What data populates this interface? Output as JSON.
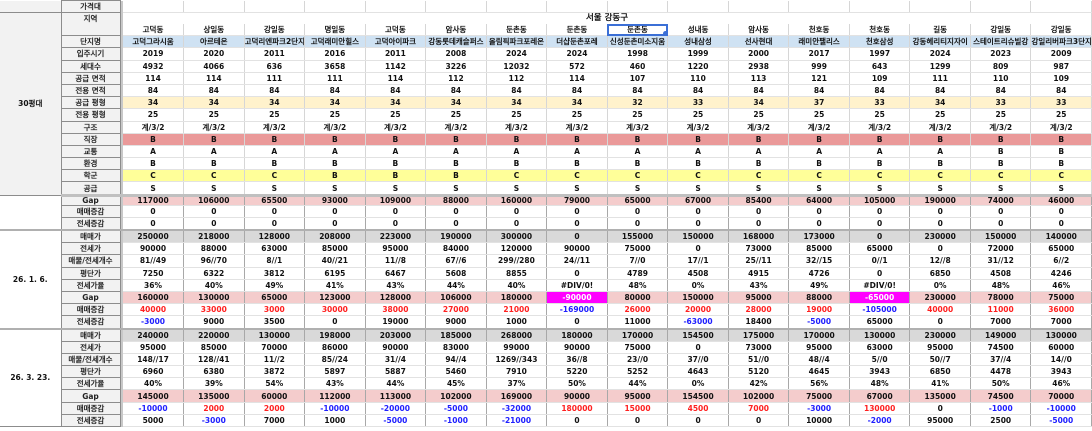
{
  "sheet": {
    "price_band_label": "가격대",
    "region_label": "지역",
    "region_title": "서울 강동구",
    "group_label": "30평대"
  },
  "dongs": [
    "고덕동",
    "상일동",
    "강일동",
    "명일동",
    "고덕동",
    "암사동",
    "둔촌동",
    "둔촌동",
    "둔촌동",
    "성내동",
    "암사동",
    "천호동",
    "천호동",
    "길동",
    "강일동",
    "강일동"
  ],
  "info_rows": [
    {
      "label": "단지명",
      "style": "blue",
      "values": [
        "고덕그라시움",
        "아르테온",
        "고덕리엔파크2단지",
        "고덕래미안힐스",
        "고덕아이파크",
        "강동롯데캐슬퍼스",
        "올림픽파크포레온",
        "더샵둔촌포레",
        "신성둔촌미소지움",
        "성내삼성",
        "선사현대",
        "래미안팰리스",
        "천호삼성",
        "강동헤리티지자이",
        "스테이트리슈빌강",
        "강일리버파크3단지"
      ]
    },
    {
      "label": "입주시기",
      "style": "",
      "values": [
        "2019",
        "2020",
        "2011",
        "2016",
        "2011",
        "2008",
        "2024",
        "2024",
        "1998",
        "1999",
        "2000",
        "2017",
        "1997",
        "2024",
        "2023",
        "2009"
      ]
    },
    {
      "label": "세대수",
      "style": "",
      "values": [
        "4932",
        "4066",
        "636",
        "3658",
        "1142",
        "3226",
        "12032",
        "572",
        "460",
        "1220",
        "2938",
        "999",
        "643",
        "1299",
        "809",
        "987"
      ]
    },
    {
      "label": "공급 면적",
      "style": "",
      "values": [
        "114",
        "114",
        "111",
        "111",
        "114",
        "112",
        "112",
        "114",
        "107",
        "110",
        "113",
        "121",
        "109",
        "111",
        "110",
        "109"
      ]
    },
    {
      "label": "전용 면적",
      "style": "",
      "values": [
        "84",
        "84",
        "84",
        "84",
        "84",
        "84",
        "84",
        "84",
        "84",
        "84",
        "84",
        "84",
        "84",
        "84",
        "84",
        "84"
      ]
    },
    {
      "label": "공급 평형",
      "style": "yellow-lite",
      "values": [
        "34",
        "34",
        "34",
        "34",
        "34",
        "34",
        "34",
        "34",
        "32",
        "33",
        "34",
        "37",
        "33",
        "34",
        "33",
        "33"
      ]
    },
    {
      "label": "전용 평형",
      "style": "",
      "values": [
        "25",
        "25",
        "25",
        "25",
        "25",
        "25",
        "25",
        "25",
        "25",
        "25",
        "25",
        "25",
        "25",
        "25",
        "25",
        "25"
      ]
    },
    {
      "label": "구조",
      "style": "",
      "values": [
        "계/3/2",
        "계/3/2",
        "계/3/2",
        "계/3/2",
        "계/3/2",
        "계/3/2",
        "계/3/2",
        "계/3/2",
        "계/3/2",
        "계/3/2",
        "계/3/2",
        "계/3/2",
        "계/3/2",
        "계/3/2",
        "계/3/2",
        "계/3/2"
      ]
    },
    {
      "label": "직장",
      "style": "red",
      "values": [
        "B",
        "B",
        "B",
        "B",
        "B",
        "B",
        "B",
        "B",
        "B",
        "B",
        "B",
        "B",
        "B",
        "B",
        "B",
        "B"
      ]
    },
    {
      "label": "교통",
      "style": "",
      "values": [
        "A",
        "A",
        "A",
        "A",
        "A",
        "A",
        "A",
        "A",
        "A",
        "A",
        "A",
        "A",
        "A",
        "A",
        "B",
        "B"
      ]
    },
    {
      "label": "환경",
      "style": "",
      "values": [
        "B",
        "B",
        "B",
        "B",
        "B",
        "B",
        "B",
        "B",
        "B",
        "B",
        "B",
        "B",
        "B",
        "B",
        "B",
        "B"
      ]
    },
    {
      "label": "학군",
      "style": "yellow",
      "values": [
        "C",
        "C",
        "C",
        "B",
        "B",
        "B",
        "C",
        "C",
        "C",
        "C",
        "C",
        "C",
        "C",
        "C",
        "C",
        "C"
      ]
    },
    {
      "label": "공급",
      "style": "",
      "values": [
        "S",
        "S",
        "S",
        "S",
        "S",
        "S",
        "S",
        "S",
        "S",
        "S",
        "S",
        "S",
        "S",
        "S",
        "S",
        "S"
      ]
    }
  ],
  "blocks": [
    {
      "date": "",
      "rows": [
        {
          "label": "Gap",
          "type": "gap",
          "values": [
            "117000",
            "106000",
            "65500",
            "93000",
            "109000",
            "88000",
            "160000",
            "79000",
            "65000",
            "67000",
            "85400",
            "64000",
            "105000",
            "190000",
            "74000",
            "46000"
          ]
        },
        {
          "label": "매매증감",
          "type": "chg-sale",
          "values": [
            "0",
            "0",
            "0",
            "0",
            "0",
            "0",
            "0",
            "0",
            "0",
            "0",
            "0",
            "0",
            "0",
            "0",
            "0",
            "0"
          ]
        },
        {
          "label": "전세증감",
          "type": "chg-jeonse",
          "values": [
            "0",
            "0",
            "0",
            "0",
            "0",
            "0",
            "0",
            "0",
            "0",
            "0",
            "0",
            "0",
            "0",
            "0",
            "0",
            "0"
          ]
        }
      ]
    },
    {
      "date": "26. 1. 6.",
      "rows": [
        {
          "label": "매매가",
          "type": "sale",
          "values": [
            "250000",
            "218000",
            "128000",
            "208000",
            "223000",
            "190000",
            "300000",
            "0",
            "155000",
            "150000",
            "168000",
            "173000",
            "0",
            "230000",
            "150000",
            "140000"
          ]
        },
        {
          "label": "전세가",
          "type": "plain",
          "values": [
            "90000",
            "88000",
            "63000",
            "85000",
            "95000",
            "84000",
            "120000",
            "90000",
            "75000",
            "0",
            "73000",
            "85000",
            "65000",
            "0",
            "72000",
            "65000"
          ]
        },
        {
          "label": "매물/전세개수",
          "type": "plain",
          "values": [
            "81//49",
            "96//70",
            "8//1",
            "40//21",
            "11//8",
            "67//6",
            "299//280",
            "24//11",
            "7//0",
            "17//1",
            "25//11",
            "32//15",
            "0//1",
            "12//8",
            "31//12",
            "6//2"
          ]
        },
        {
          "label": "평단가",
          "type": "plain",
          "values": [
            "7250",
            "6322",
            "3812",
            "6195",
            "6467",
            "5608",
            "8855",
            "0",
            "4789",
            "4508",
            "4915",
            "4726",
            "0",
            "6850",
            "4508",
            "4246"
          ]
        },
        {
          "label": "전세가율",
          "type": "plain",
          "values": [
            "36%",
            "40%",
            "49%",
            "41%",
            "43%",
            "44%",
            "40%",
            "#DIV/0!",
            "48%",
            "0%",
            "43%",
            "49%",
            "#DIV/0!",
            "0%",
            "48%",
            "46%"
          ]
        },
        {
          "label": "Gap",
          "type": "gap",
          "values": [
            "160000",
            "130000",
            "65000",
            "123000",
            "128000",
            "106000",
            "180000",
            "-90000",
            "80000",
            "150000",
            "95000",
            "88000",
            "-65000",
            "230000",
            "78000",
            "75000"
          ]
        },
        {
          "label": "매매증감",
          "type": "chg-sale",
          "values": [
            "40000",
            "33000",
            "3000",
            "30000",
            "38000",
            "27000",
            "21000",
            "-169000",
            "26000",
            "20000",
            "28000",
            "19000",
            "-105000",
            "40000",
            "11000",
            "36000"
          ]
        },
        {
          "label": "전세증감",
          "type": "chg-jeonse",
          "values": [
            "-3000",
            "9000",
            "3500",
            "0",
            "19000",
            "9000",
            "1000",
            "0",
            "11000",
            "-63000",
            "18400",
            "-5000",
            "65000",
            "0",
            "7000",
            "7000"
          ]
        }
      ]
    },
    {
      "date": "26. 3. 23.",
      "rows": [
        {
          "label": "매매가",
          "type": "sale",
          "values": [
            "240000",
            "220000",
            "130000",
            "198000",
            "203000",
            "185000",
            "268000",
            "180000",
            "170000",
            "154500",
            "175000",
            "170000",
            "130000",
            "230000",
            "149000",
            "130000"
          ]
        },
        {
          "label": "전세가",
          "type": "plain",
          "values": [
            "95000",
            "85000",
            "70000",
            "86000",
            "90000",
            "83000",
            "99000",
            "90000",
            "75000",
            "0",
            "73000",
            "95000",
            "63000",
            "95000",
            "74500",
            "60000"
          ]
        },
        {
          "label": "매물/전세개수",
          "type": "plain",
          "values": [
            "148//17",
            "128//41",
            "11//2",
            "85//24",
            "31//4",
            "94//4",
            "1269//343",
            "36//8",
            "23//0",
            "37//0",
            "51//0",
            "48//4",
            "5//0",
            "50//7",
            "37//4",
            "14//0"
          ]
        },
        {
          "label": "평단가",
          "type": "plain",
          "values": [
            "6960",
            "6380",
            "3872",
            "5897",
            "5887",
            "5460",
            "7910",
            "5220",
            "5252",
            "4643",
            "5120",
            "4645",
            "3943",
            "6850",
            "4478",
            "3943"
          ]
        },
        {
          "label": "전세가율",
          "type": "plain",
          "values": [
            "40%",
            "39%",
            "54%",
            "43%",
            "44%",
            "45%",
            "37%",
            "50%",
            "44%",
            "0%",
            "42%",
            "56%",
            "48%",
            "41%",
            "50%",
            "46%"
          ]
        },
        {
          "label": "Gap",
          "type": "gap",
          "values": [
            "145000",
            "135000",
            "60000",
            "112000",
            "113000",
            "102000",
            "169000",
            "90000",
            "95000",
            "154500",
            "102000",
            "75000",
            "67000",
            "135000",
            "74500",
            "70000"
          ]
        },
        {
          "label": "매매증감",
          "type": "chg-sale",
          "values": [
            "-10000",
            "2000",
            "2000",
            "-10000",
            "-20000",
            "-5000",
            "-32000",
            "180000",
            "15000",
            "4500",
            "7000",
            "-3000",
            "130000",
            "0",
            "-1000",
            "-10000"
          ]
        },
        {
          "label": "전세증감",
          "type": "chg-jeonse",
          "values": [
            "5000",
            "-3000",
            "7000",
            "1000",
            "-5000",
            "-1000",
            "-21000",
            "0",
            "0",
            "0",
            "0",
            "10000",
            "-2000",
            "95000",
            "2500",
            "-5000"
          ]
        }
      ]
    }
  ],
  "selected_cell": {
    "row": "dongs",
    "col": 8
  }
}
